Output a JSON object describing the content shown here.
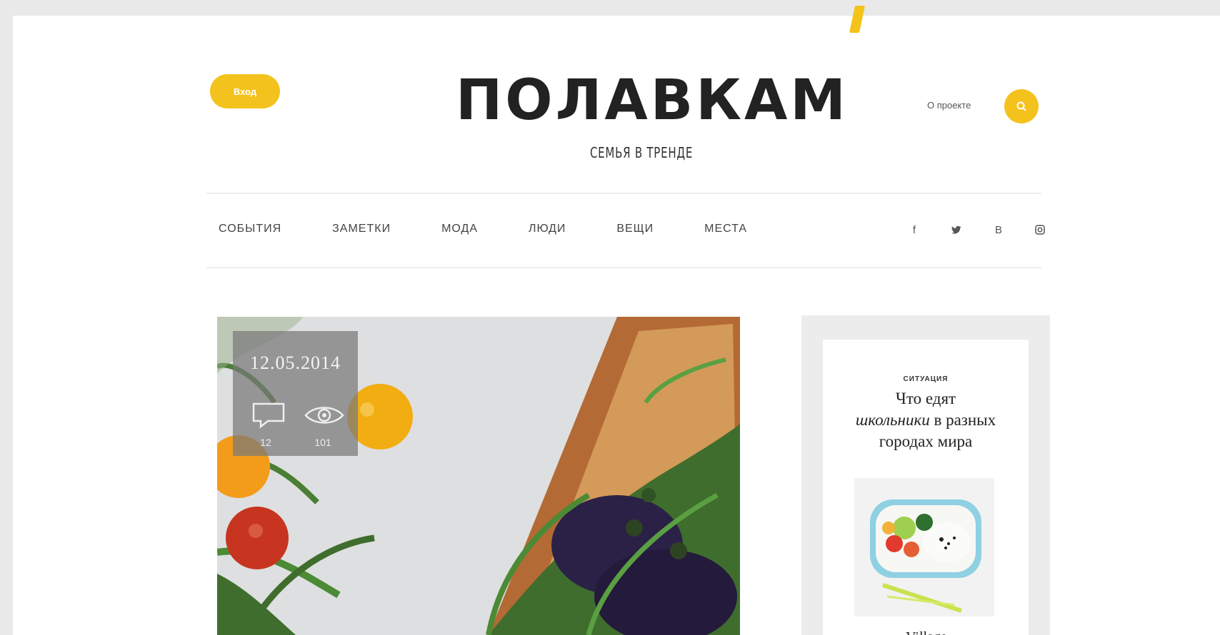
{
  "header": {
    "login_label": "Вход",
    "logo_text": "ПОЛАВКАМ",
    "tagline": "СЕМЬЯ В ТРЕНДЕ",
    "about_label": "О проекте"
  },
  "nav": {
    "items": [
      {
        "label": "СОБЫТИЯ"
      },
      {
        "label": "ЗАМЕТКИ"
      },
      {
        "label": "МОДА"
      },
      {
        "label": "ЛЮДИ"
      },
      {
        "label": "ВЕЩИ"
      },
      {
        "label": "МЕСТА"
      }
    ],
    "social": [
      {
        "icon": "facebook-icon",
        "glyph": "f"
      },
      {
        "icon": "twitter-icon",
        "glyph": "🐦"
      },
      {
        "icon": "vk-icon",
        "glyph": "B"
      },
      {
        "icon": "instagram-icon",
        "glyph": "◎"
      }
    ]
  },
  "hero": {
    "date": "12.05.2014",
    "comments_count": "12",
    "views_count": "101"
  },
  "sidebar_card": {
    "kicker": "СИТУАЦИЯ",
    "title_line1": "Что едят",
    "title_italic": "школьники",
    "title_line2": "в разных городах мира",
    "footer_text": "Village"
  },
  "colors": {
    "accent": "#f4c21d",
    "background": "#e9e9e9",
    "text": "#222222"
  }
}
